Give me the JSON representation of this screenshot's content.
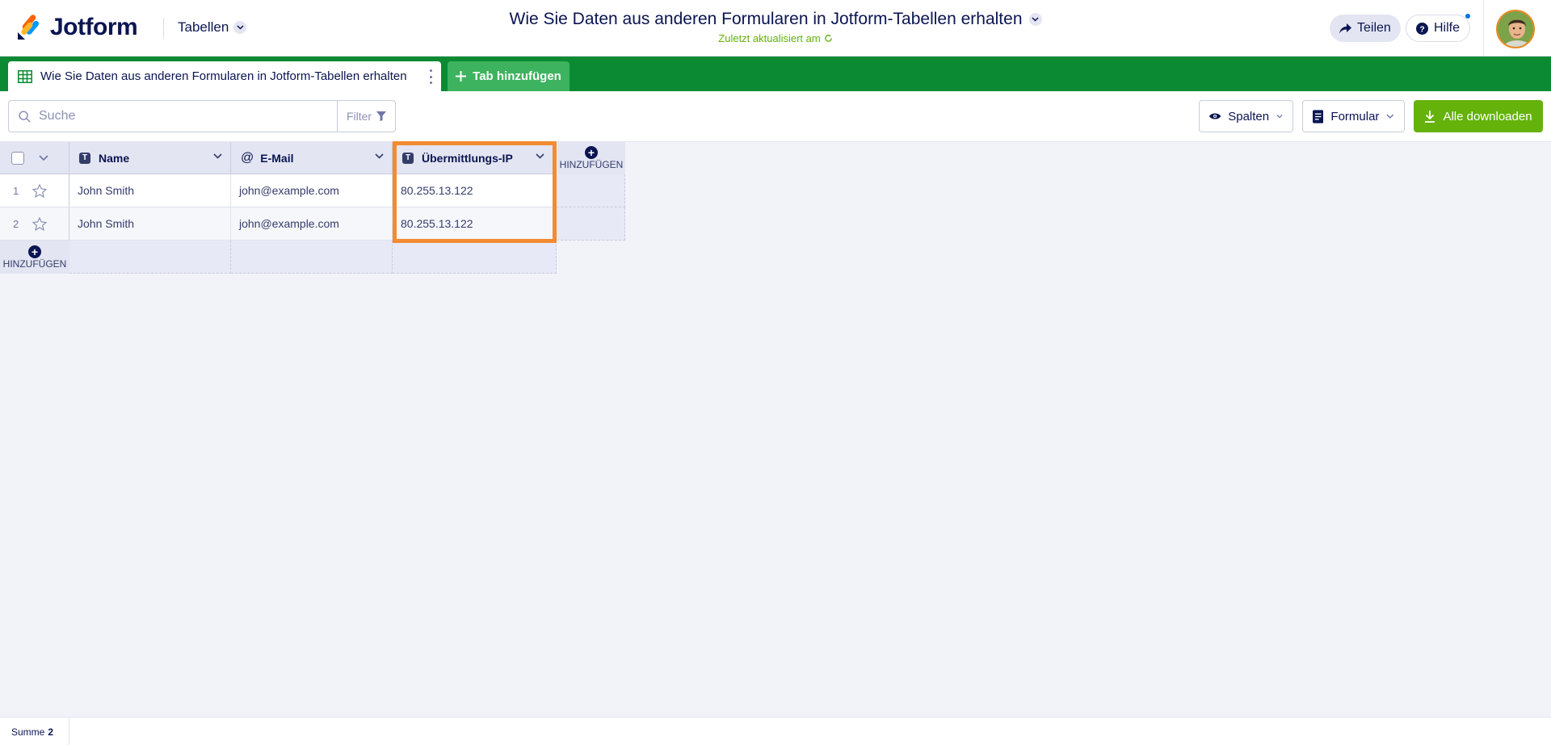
{
  "brand": {
    "name": "Jotform",
    "product_switch": "Tabellen"
  },
  "document": {
    "title": "Wie Sie Daten aus anderen Formularen in Jotform-Tabellen erhalten",
    "subtitle": "Zuletzt aktualisiert am"
  },
  "header_actions": {
    "share_label": "Teilen",
    "help_label": "Hilfe"
  },
  "tabs": {
    "active_label": "Wie Sie Daten aus anderen Formularen in Jotform-Tabellen erhalten",
    "add_label": "Tab hinzufügen"
  },
  "toolbar": {
    "search_placeholder": "Suche",
    "filter_label": "Filter",
    "columns_label": "Spalten",
    "form_label": "Formular",
    "download_label": "Alle downloaden"
  },
  "table": {
    "columns": [
      {
        "label": "Name",
        "type_icon": "text-type-icon"
      },
      {
        "label": "E-Mail",
        "type_icon": "at-icon"
      },
      {
        "label": "Übermittlungs-IP",
        "type_icon": "text-type-icon"
      }
    ],
    "add_column_label": "HINZUFÜGEN",
    "add_row_label": "HINZUFÜGEN",
    "rows": [
      {
        "num": "1",
        "name": "John Smith",
        "email": "john@example.com",
        "ip": "80.255.13.122"
      },
      {
        "num": "2",
        "name": "John Smith",
        "email": "john@example.com",
        "ip": "80.255.13.122"
      }
    ]
  },
  "footer": {
    "sum_label": "Summe",
    "sum_value": "2"
  },
  "colors": {
    "brand_green": "#0b8a33",
    "accent_green": "#64b20a",
    "highlight_orange": "#f28b32",
    "navy": "#0a1551"
  }
}
